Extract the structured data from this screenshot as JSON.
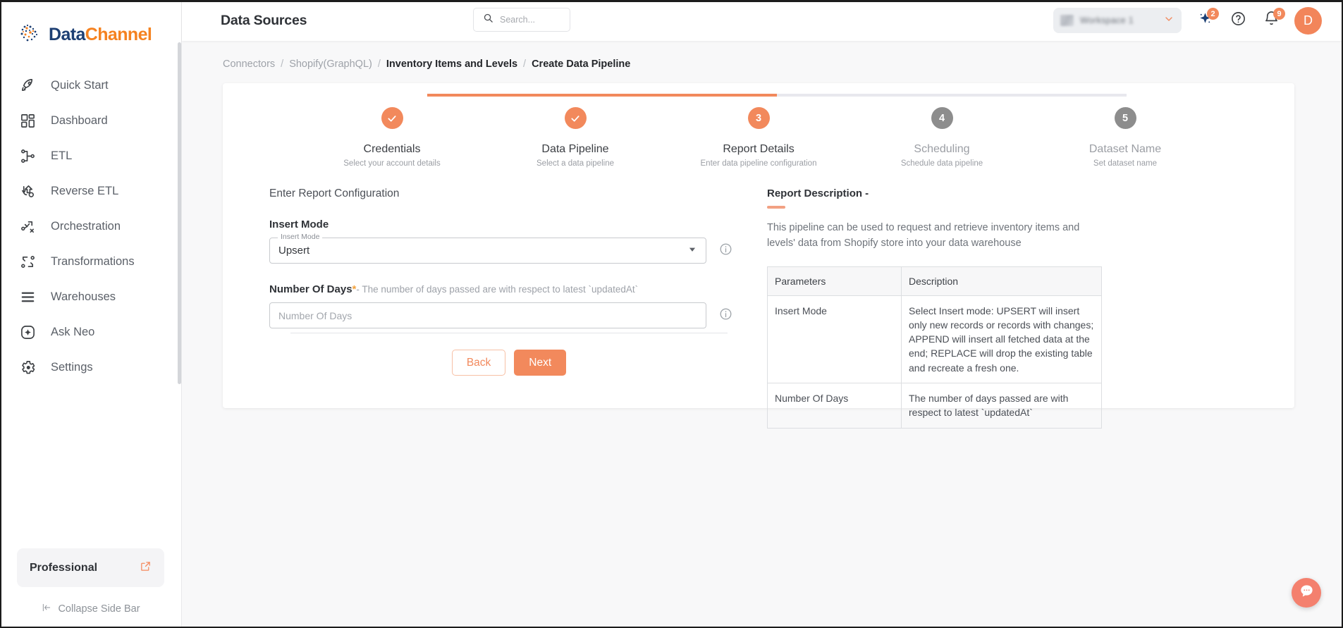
{
  "brand": {
    "part1": "Data",
    "part2": "Channel",
    "logo_icon": "datachannel-logo-icon"
  },
  "sidebar": {
    "items": [
      {
        "label": "Quick Start",
        "icon": "rocket-icon"
      },
      {
        "label": "Dashboard",
        "icon": "grid-icon"
      },
      {
        "label": "ETL",
        "icon": "etl-nodes-icon"
      },
      {
        "label": "Reverse ETL",
        "icon": "reverse-etl-icon"
      },
      {
        "label": "Orchestration",
        "icon": "orchestration-icon"
      },
      {
        "label": "Transformations",
        "icon": "transformations-icon"
      },
      {
        "label": "Warehouses",
        "icon": "warehouse-stack-icon"
      },
      {
        "label": "Ask Neo",
        "icon": "sparkle-square-icon"
      },
      {
        "label": "Settings",
        "icon": "gear-icon"
      }
    ],
    "plan": {
      "label": "Professional",
      "icon": "external-link-icon"
    },
    "collapse": {
      "label": "Collapse Side Bar",
      "icon": "collapse-left-icon"
    }
  },
  "header": {
    "title": "Data Sources",
    "search": {
      "placeholder": "Search...",
      "icon": "search-icon",
      "value": ""
    },
    "workspace": {
      "name": "Workspace 1",
      "caret_icon": "chevron-down-icon",
      "logo_icon": "workspace-logo-icon"
    },
    "ai": {
      "icon": "sparkle-icon",
      "badge": "2"
    },
    "help": {
      "icon": "help-circle-icon"
    },
    "notifications": {
      "icon": "bell-icon",
      "badge": "9"
    },
    "avatar": {
      "initial": "D"
    }
  },
  "breadcrumb": {
    "items": [
      "Connectors",
      "Shopify(GraphQL)",
      "Inventory Items and Levels",
      "Create Data Pipeline"
    ],
    "separator": "/"
  },
  "stepper": {
    "steps": [
      {
        "marker": "✓",
        "state": "done",
        "title": "Credentials",
        "sub": "Select your account details"
      },
      {
        "marker": "✓",
        "state": "done",
        "title": "Data Pipeline",
        "sub": "Select a data pipeline"
      },
      {
        "marker": "3",
        "state": "active",
        "title": "Report Details",
        "sub": "Enter data pipeline configuration"
      },
      {
        "marker": "4",
        "state": "todo",
        "title": "Scheduling",
        "sub": "Schedule data pipeline"
      },
      {
        "marker": "5",
        "state": "todo",
        "title": "Dataset Name",
        "sub": "Set dataset name"
      }
    ]
  },
  "form": {
    "heading": "Enter Report Configuration",
    "insert_mode": {
      "label": "Insert Mode",
      "float_label": "Insert Mode",
      "value": "Upsert",
      "caret_icon": "dropdown-arrow-icon",
      "info_icon": "info-circle-icon"
    },
    "number_of_days": {
      "label": "Number Of Days",
      "required_mark": "*",
      "hint": "- The number of days passed are with respect to latest `updatedAt`",
      "placeholder": "Number Of Days",
      "value": "",
      "info_icon": "info-circle-icon"
    },
    "buttons": {
      "back": "Back",
      "next": "Next"
    }
  },
  "report_description": {
    "title": "Report Description -",
    "body": "This pipeline can be used to request and retrieve inventory items and levels' data from Shopify store into your data warehouse",
    "table": {
      "headers": [
        "Parameters",
        "Description"
      ],
      "rows": [
        {
          "parameter": "Insert Mode",
          "description": "Select Insert mode: UPSERT will insert only new records or records with changes; APPEND will insert all fetched data at the end; REPLACE will drop the existing table and recreate a fresh one."
        },
        {
          "parameter": "Number Of Days",
          "description": "The number of days passed are with respect to latest `updatedAt`"
        }
      ]
    }
  },
  "chat": {
    "icon": "chat-bubble-icon"
  },
  "colors": {
    "accent": "#f2895c",
    "brand_blue": "#1d3f73",
    "brand_orange": "#f58220",
    "step_todo": "#8d8d8d",
    "chat": "#f4806e"
  }
}
